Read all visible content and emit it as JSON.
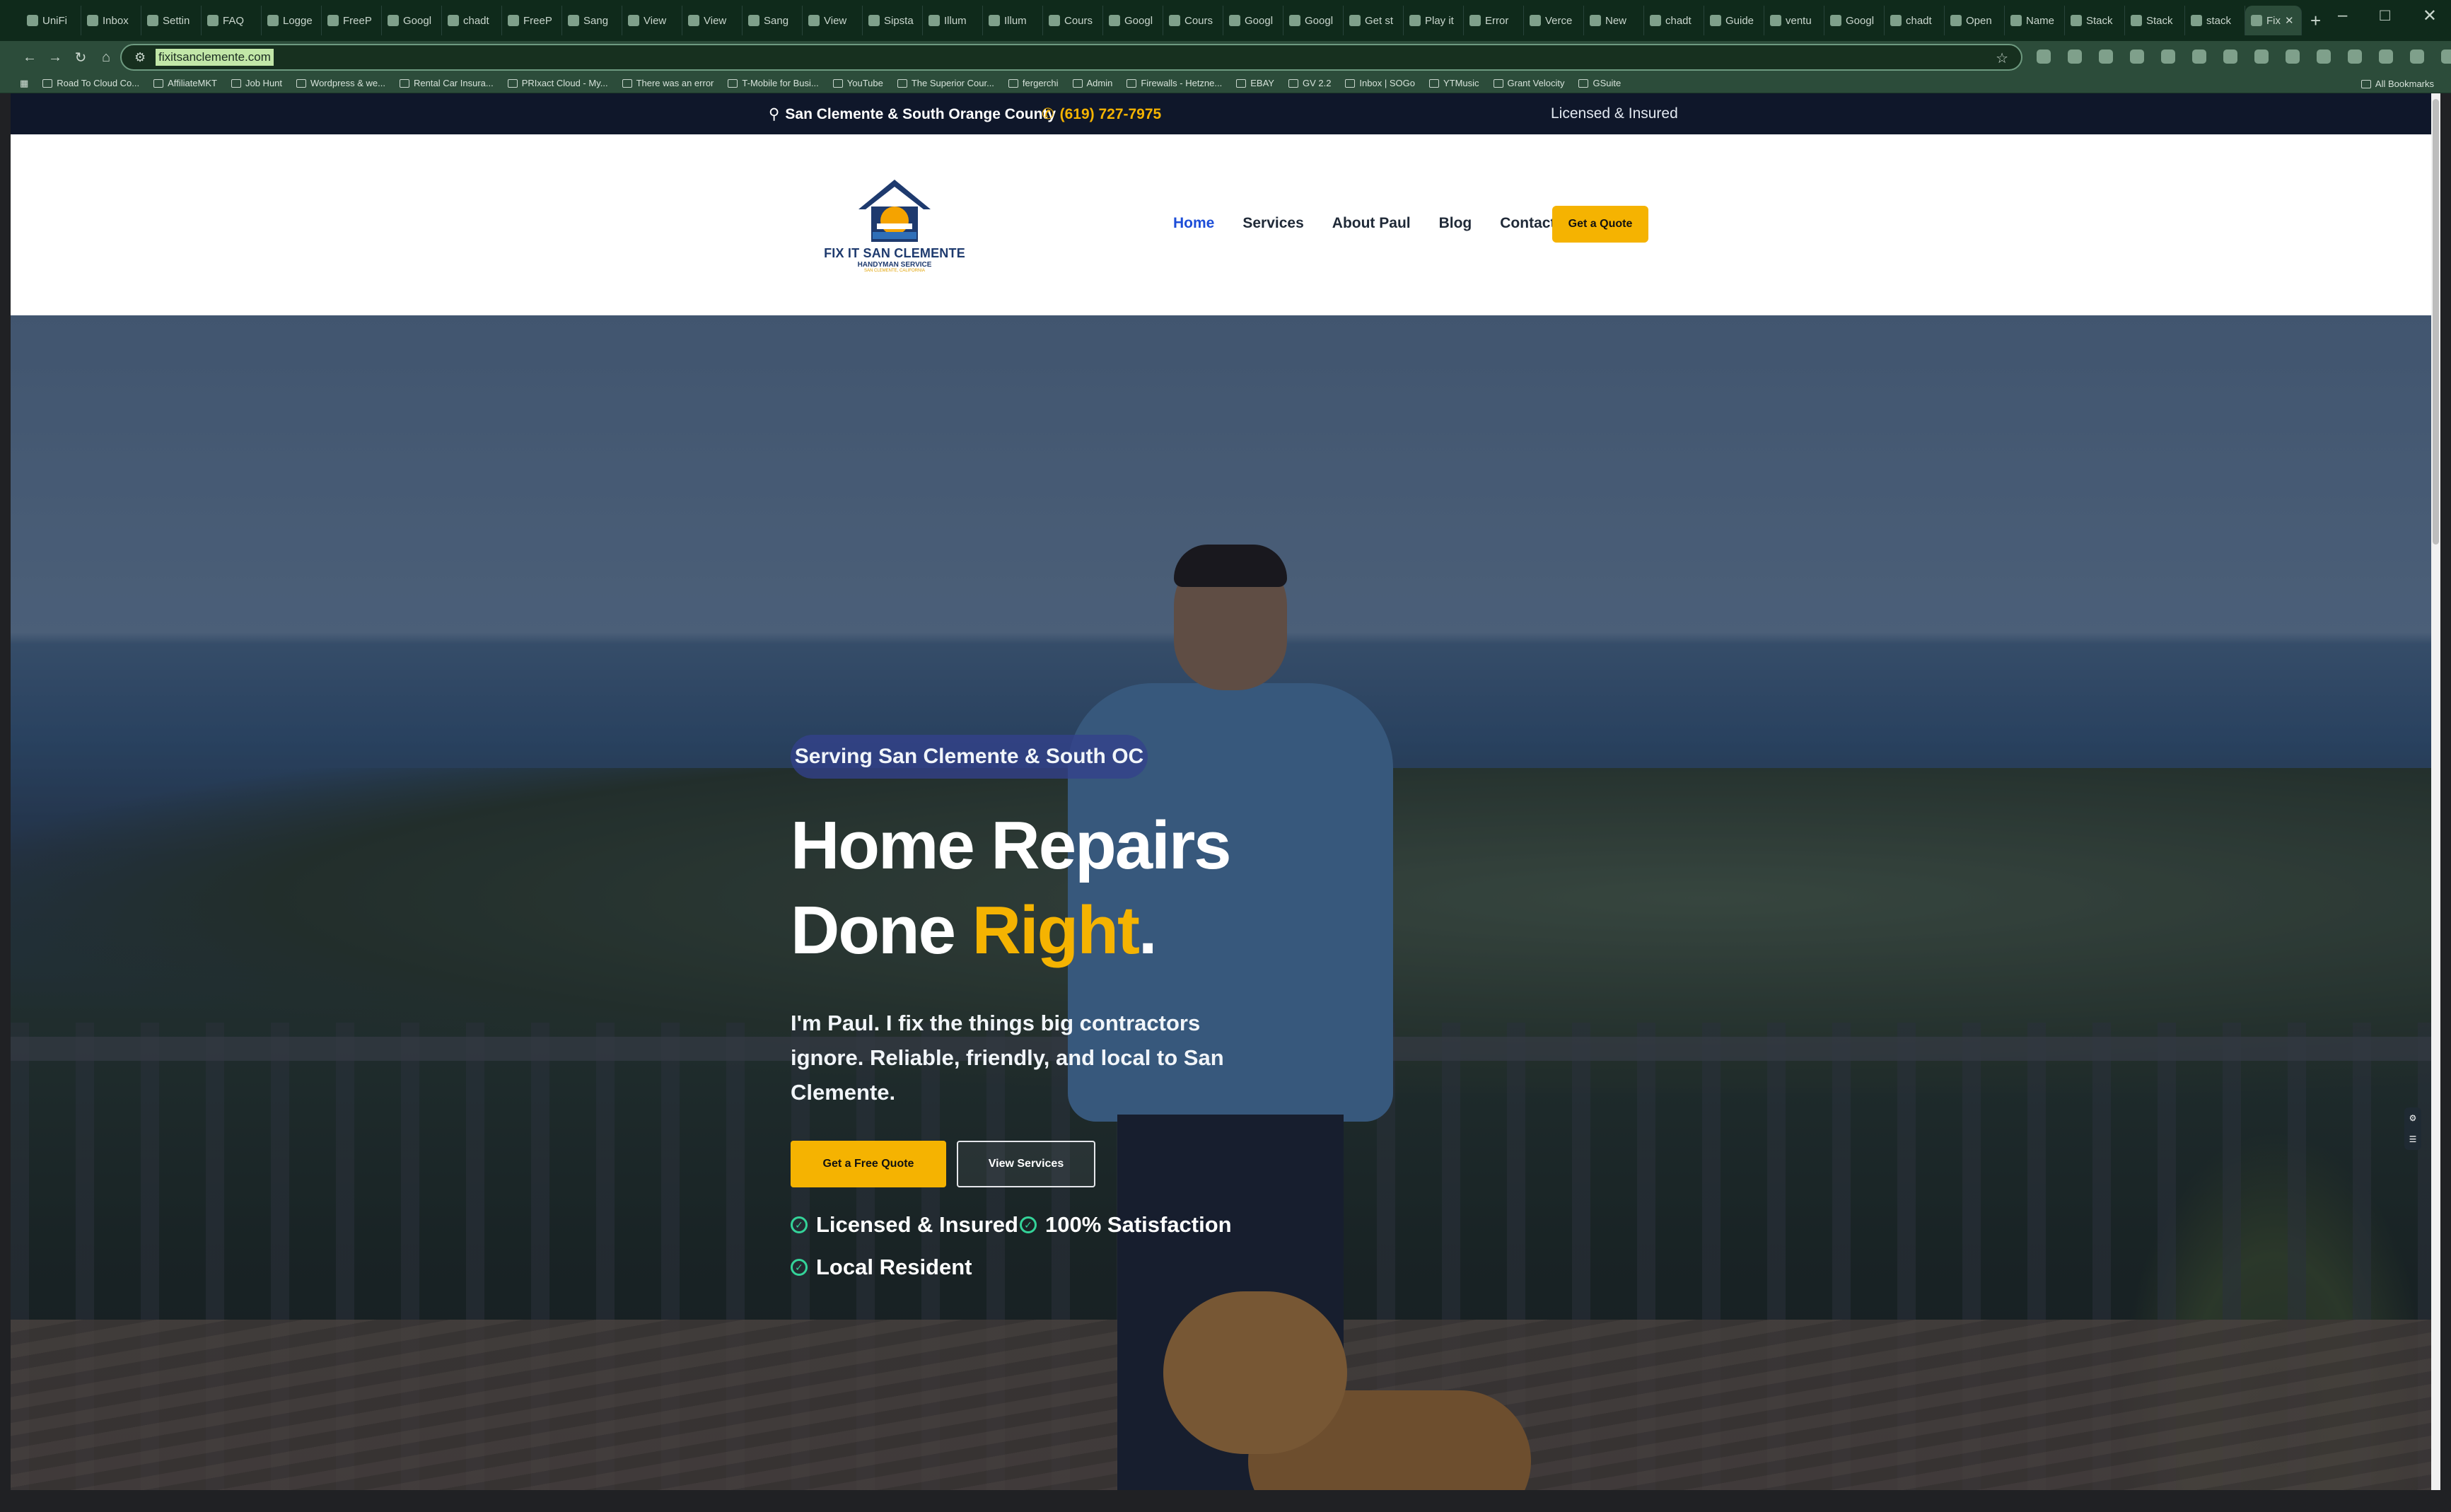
{
  "browser": {
    "tabs": [
      {
        "label": "UniFi",
        "icon": "unifi-icon"
      },
      {
        "label": "Inbox",
        "icon": "mail-icon"
      },
      {
        "label": "Settin",
        "icon": "gear-icon"
      },
      {
        "label": "FAQ",
        "icon": "h-icon"
      },
      {
        "label": "Logge",
        "icon": "h-icon"
      },
      {
        "label": "FreeP",
        "icon": "frog-icon"
      },
      {
        "label": "Googl",
        "icon": "google-icon"
      },
      {
        "label": "chadt",
        "icon": "github-icon"
      },
      {
        "label": "FreeP",
        "icon": "frog-icon"
      },
      {
        "label": "Sang",
        "icon": "globe-icon"
      },
      {
        "label": "View",
        "icon": "globe-icon"
      },
      {
        "label": "View",
        "icon": "globe-icon"
      },
      {
        "label": "Sang",
        "icon": "globe-icon"
      },
      {
        "label": "View",
        "icon": "globe-icon"
      },
      {
        "label": "Sipsta",
        "icon": "s-icon"
      },
      {
        "label": "Illum",
        "icon": "triangle-icon"
      },
      {
        "label": "Illum",
        "icon": "triangle-icon"
      },
      {
        "label": "Cours",
        "icon": "c-icon"
      },
      {
        "label": "Googl",
        "icon": "c-icon"
      },
      {
        "label": "Cours",
        "icon": "c-icon"
      },
      {
        "label": "Googl",
        "icon": "c-icon"
      },
      {
        "label": "Googl",
        "icon": "c-icon"
      },
      {
        "label": "Get st",
        "icon": "c-icon"
      },
      {
        "label": "Play it",
        "icon": "globe-icon"
      },
      {
        "label": "Error",
        "icon": "gear-icon"
      },
      {
        "label": "Verce",
        "icon": "vercel-icon"
      },
      {
        "label": "New",
        "icon": "vercel-icon"
      },
      {
        "label": "chadt",
        "icon": "github-icon"
      },
      {
        "label": "Guide",
        "icon": "vercel-icon"
      },
      {
        "label": "ventu",
        "icon": "bolt-icon"
      },
      {
        "label": "Googl",
        "icon": "google-icon"
      },
      {
        "label": "chadt",
        "icon": "github-icon"
      },
      {
        "label": "Open",
        "icon": "share-icon"
      },
      {
        "label": "Name",
        "icon": "ai-icon"
      },
      {
        "label": "Stack",
        "icon": "globe-icon"
      },
      {
        "label": "Stack",
        "icon": "globe-icon"
      },
      {
        "label": "stack",
        "icon": "vercel-icon"
      },
      {
        "label": "Fix",
        "icon": "globe-icon",
        "active": true
      }
    ],
    "new_tab": "+",
    "url": "fixitsanclemente.com",
    "bookmarks": [
      "Road To Cloud Co...",
      "AffiliateMKT",
      "Job Hunt",
      "Wordpress & we...",
      "Rental Car Insura...",
      "PRIxact Cloud - My...",
      "There was an error",
      "T-Mobile for Busi...",
      "YouTube",
      "The Superior Cour...",
      "fergerchi",
      "Admin",
      "Firewalls - Hetzne...",
      "EBAY",
      "GV 2.2",
      "Inbox | SOGo",
      "YTMusic",
      "Grant Velocity",
      "GSuite"
    ],
    "all_bookmarks": "All Bookmarks"
  },
  "site": {
    "topbar": {
      "location": "San Clemente & South Orange County",
      "phone": "(619) 727-7975",
      "licensed": "Licensed & Insured"
    },
    "logo": {
      "name": "FIX IT SAN CLEMENTE",
      "tagline": "HANDYMAN SERVICE",
      "subline": "SAN CLEMENTE, CALIFORNIA"
    },
    "nav": {
      "items": [
        "Home",
        "Services",
        "About Paul",
        "Blog",
        "Contact"
      ],
      "active": "Home",
      "cta": "Get a Quote"
    },
    "hero": {
      "badge": "Serving San Clemente & South OC",
      "title_line1": "Home Repairs",
      "title_line2_prefix": "Done ",
      "title_line2_highlight": "Right",
      "title_line2_suffix": ".",
      "subtitle": "I'm Paul. I fix the things big contractors ignore. Reliable, friendly, and local to San Clemente.",
      "cta_primary": "Get a Free Quote",
      "cta_secondary": "View Services",
      "features": [
        "Licensed & Insured",
        "100% Satisfaction",
        "Local Resident"
      ]
    }
  },
  "colors": {
    "accent": "#f5b301",
    "topbar_bg": "#0f172a",
    "nav_active": "#1d4ed8",
    "check": "#34d399"
  }
}
